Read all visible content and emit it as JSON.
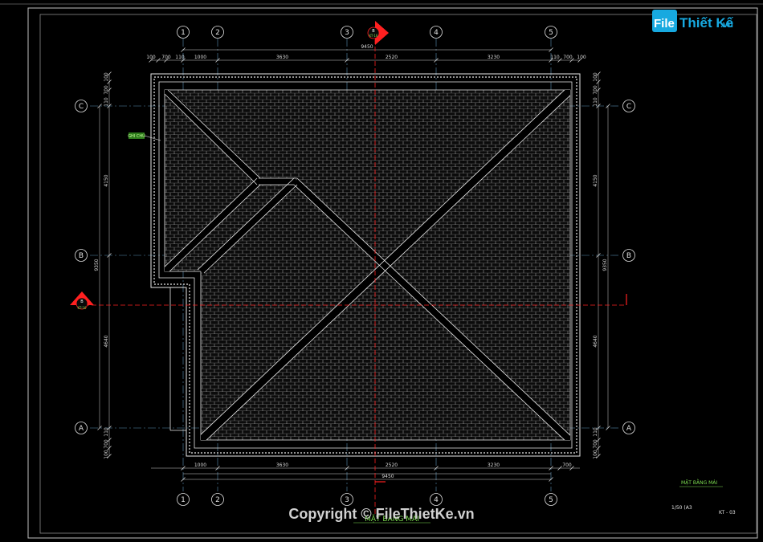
{
  "logo": {
    "brand_prefix": "File",
    "brand_rest": "Thiết Kế",
    "brand_suffix": ".vn"
  },
  "watermark": {
    "copyright": "Copyright © FileThietKe.vn"
  },
  "drawing": {
    "title": "MẶT BẰNG MÁI",
    "scale": "1/50  (A3",
    "sheet": "KT - 03",
    "bottom_label": "MẶT BẰNG MÁI",
    "callout_tag": "GHI CHÚ",
    "section_mark": "B",
    "section_sheet": "KT-16"
  },
  "grid": {
    "vertical": [
      "1",
      "2",
      "3",
      "4",
      "5"
    ],
    "horizontal": [
      "C",
      "B",
      "A"
    ]
  },
  "dimensions": {
    "top_total": "9450",
    "top_segments": [
      "1000",
      "3630",
      "2520",
      "3230"
    ],
    "top_small": [
      "100",
      "700",
      "110",
      "110",
      "700",
      "100"
    ],
    "bottom_total": "9450",
    "bottom_segments": [
      "1000",
      "3630",
      "2520",
      "3230"
    ],
    "bottom_small": [
      "700"
    ],
    "left_total": "9350",
    "left_segments": [
      "4150",
      "4640"
    ],
    "left_small": [
      "100",
      "700",
      "110",
      "110",
      "700",
      "100"
    ],
    "right_total": "9350",
    "right_segments": [
      "4150",
      "4640"
    ],
    "right_small": [
      "100",
      "700",
      "110",
      "110",
      "700",
      "100"
    ]
  },
  "colors": {
    "background": "#000000",
    "lines": "#e8e8e8",
    "axis": "#5a8fb3",
    "section": "#ff2020",
    "accent_green": "#7cdc50",
    "logo_blue": "#17a9e0"
  }
}
